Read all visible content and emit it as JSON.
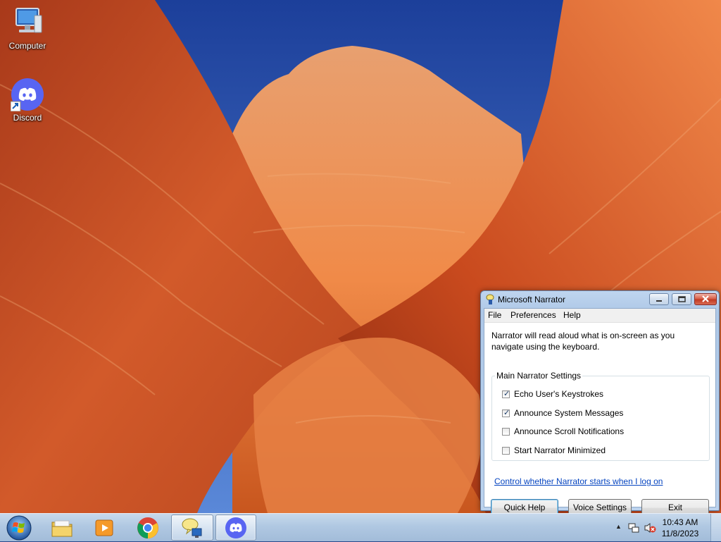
{
  "desktop": {
    "icons": [
      {
        "label": "Computer",
        "icon": "computer-icon"
      },
      {
        "label": "Discord",
        "icon": "discord-icon"
      }
    ]
  },
  "narrator": {
    "title": "Microsoft Narrator",
    "menu": [
      "File",
      "Preferences",
      "Help"
    ],
    "description": "Narrator will read aloud what is on-screen as you navigate using the keyboard.",
    "group_title": "Main Narrator Settings",
    "options": [
      {
        "label": "Echo User's Keystrokes",
        "checked": true
      },
      {
        "label": "Announce System Messages",
        "checked": true
      },
      {
        "label": "Announce Scroll Notifications",
        "checked": false
      },
      {
        "label": "Start Narrator Minimized",
        "checked": false
      }
    ],
    "link": "Control whether Narrator starts when I log on",
    "buttons": {
      "quick_help": "Quick Help",
      "voice_settings": "Voice Settings",
      "exit": "Exit"
    }
  },
  "taskbar": {
    "apps": [
      "start-orb",
      "file-explorer",
      "media-player",
      "chrome",
      "narrator",
      "discord"
    ],
    "clock": {
      "time": "10:43 AM",
      "date": "11/8/2023"
    }
  },
  "colors": {
    "taskbar": "#b0c8e2",
    "window_frame": "#aec8e7",
    "link": "#0645c0",
    "discord": "#5865f2"
  }
}
